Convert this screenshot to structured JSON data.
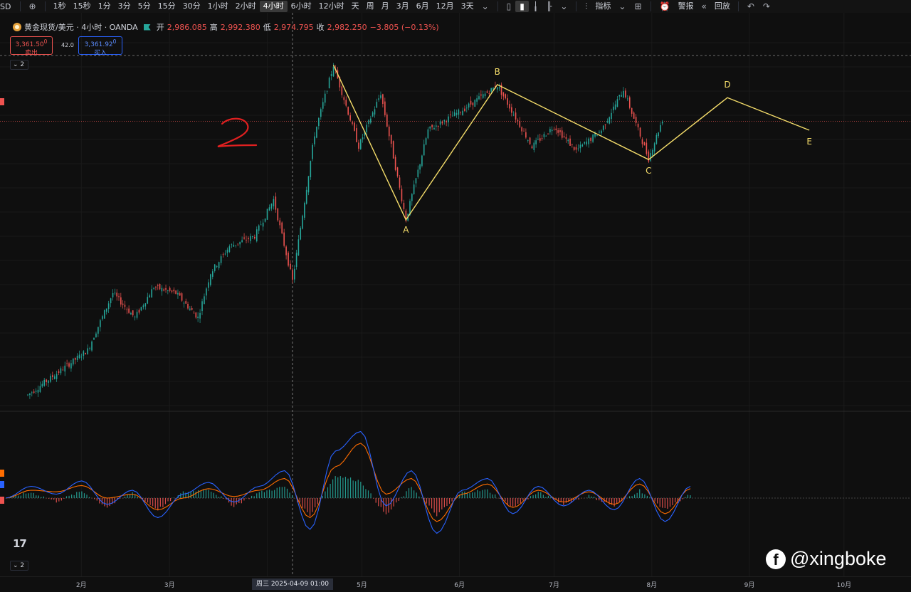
{
  "toolbar": {
    "symbol": "USD",
    "add_icon": "plus-circle-icon",
    "timeframes": [
      "1秒",
      "15秒",
      "1分",
      "3分",
      "5分",
      "15分",
      "30分",
      "1小时",
      "2小时",
      "4小时",
      "6小时",
      "12小时",
      "天",
      "周",
      "月",
      "3月",
      "6月",
      "12月",
      "3天"
    ],
    "active_timeframe": "4小时",
    "indicators_label": "指标",
    "alert_label": "警报",
    "replay_label": "回放"
  },
  "legend": {
    "title": "黄金现货/美元 · 4小时 · OANDA",
    "open_label": "开",
    "open_value": "2,986.085",
    "high_label": "高",
    "high_value": "2,992.380",
    "low_label": "低",
    "low_value": "2,974.795",
    "close_label": "收",
    "close_value": "2,982.250",
    "change": "−3.805 (−0.13%)"
  },
  "sell": {
    "price": "3,361.50",
    "sup": "0",
    "label": "卖出"
  },
  "buy": {
    "price": "3,361.92",
    "sup": "0",
    "label": "买入"
  },
  "spread": "42.0",
  "badges": {
    "top": "2",
    "bottom": "2"
  },
  "annotation_handwritten": "2",
  "wave_labels": [
    "A",
    "B",
    "C",
    "D",
    "E"
  ],
  "x_axis": {
    "ticks": [
      "2月",
      "3月",
      "5月",
      "6月",
      "7月",
      "8月",
      "9月",
      "10月"
    ],
    "crosshair": "周三 2025-04-09  01:00"
  },
  "watermark": "@xingboke",
  "colors": {
    "up": "#26a69a",
    "down": "#ef5350",
    "wave_line": "#f5dd6a",
    "macd_line": "#2962ff",
    "signal_line": "#ff6d00",
    "annotation": "#e02020"
  },
  "chart_data": {
    "type": "candlestick",
    "instrument": "黄金现货/美元",
    "timeframe": "4小时",
    "price_path": [
      {
        "t": "2025-01-15",
        "price": 2690
      },
      {
        "t": "2025-02-03",
        "price": 2800
      },
      {
        "t": "2025-02-11",
        "price": 2940
      },
      {
        "t": "2025-02-18",
        "price": 2880
      },
      {
        "t": "2025-02-24",
        "price": 2955
      },
      {
        "t": "2025-03-03",
        "price": 2940
      },
      {
        "t": "2025-03-10",
        "price": 2880
      },
      {
        "t": "2025-03-14",
        "price": 2990
      },
      {
        "t": "2025-03-20",
        "price": 3055
      },
      {
        "t": "2025-03-28",
        "price": 3080
      },
      {
        "t": "2025-04-03",
        "price": 3170
      },
      {
        "t": "2025-04-09",
        "price": 2970
      },
      {
        "t": "2025-04-16",
        "price": 3330
      },
      {
        "t": "2025-04-22",
        "price": 3500
      },
      {
        "t": "2025-04-30",
        "price": 3300
      },
      {
        "t": "2025-05-07",
        "price": 3430
      },
      {
        "t": "2025-05-15",
        "price": 3120
      },
      {
        "t": "2025-05-22",
        "price": 3340
      },
      {
        "t": "2025-06-02",
        "price": 3390
      },
      {
        "t": "2025-06-13",
        "price": 3450
      },
      {
        "t": "2025-06-24",
        "price": 3300
      },
      {
        "t": "2025-07-01",
        "price": 3350
      },
      {
        "t": "2025-07-08",
        "price": 3290
      },
      {
        "t": "2025-07-16",
        "price": 3340
      },
      {
        "t": "2025-07-23",
        "price": 3440
      },
      {
        "t": "2025-07-31",
        "price": 3270
      },
      {
        "t": "2025-08-05",
        "price": 3380
      }
    ],
    "wave_points": [
      {
        "label": "",
        "t": "2025-04-22",
        "price": 3500
      },
      {
        "label": "A",
        "t": "2025-05-15",
        "price": 3120
      },
      {
        "label": "B",
        "t": "2025-06-13",
        "price": 3452
      },
      {
        "label": "C",
        "t": "2025-07-31",
        "price": 3268
      },
      {
        "label": "D",
        "t": "2025-08-25",
        "price": 3420
      },
      {
        "label": "E",
        "t": "2025-09-20",
        "price": 3340
      }
    ],
    "current_price": 3361.5,
    "y_range": [
      2650,
      3520
    ],
    "x_range": [
      "2025-01-08",
      "2025-10-20"
    ],
    "macd": {
      "fast_line": [
        0,
        15,
        5,
        22,
        -8,
        10,
        -25,
        5,
        20,
        -5,
        15,
        35,
        -40,
        60,
        85,
        -10,
        35,
        -45,
        10,
        25,
        -20,
        15,
        -10,
        10,
        -15,
        25,
        -30,
        15
      ],
      "slow_line": [
        0,
        10,
        8,
        16,
        0,
        5,
        -15,
        0,
        12,
        2,
        10,
        25,
        -25,
        40,
        70,
        5,
        25,
        -30,
        5,
        18,
        -12,
        10,
        -5,
        8,
        -8,
        18,
        -20,
        12
      ]
    }
  }
}
